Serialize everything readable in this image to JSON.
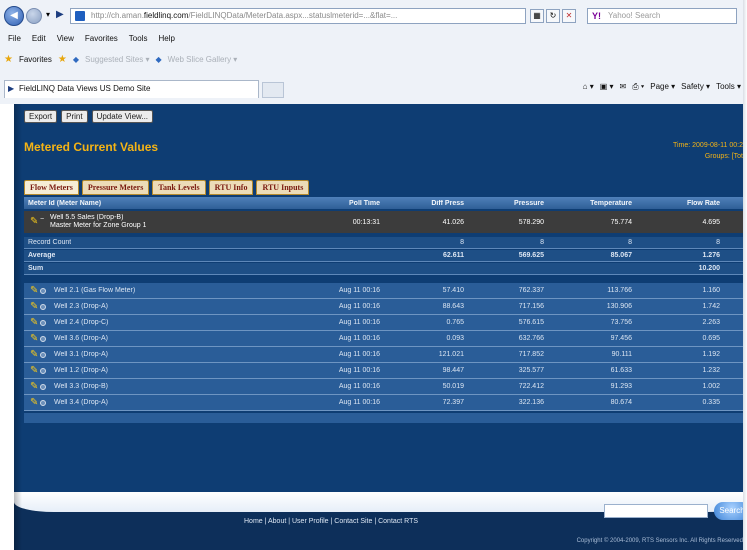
{
  "browser": {
    "url_prefix": "http://ch.aman.",
    "url_domain": "fieldlinq.com",
    "url_rest": "/FieldLINQData/MeterData.aspx...statuslmeterid=...&flat=...",
    "search_placeholder": "Yahoo! Search",
    "menu": [
      "File",
      "Edit",
      "View",
      "Favorites",
      "Tools",
      "Help"
    ],
    "favorites_label": "Favorites",
    "fav_links": [
      "Suggested Sites ▾",
      "Web Slice Gallery ▾"
    ],
    "tab_title": "FieldLINQ Data Views US Demo Site",
    "cmd": [
      "Page ▾",
      "Safety ▾",
      "Tools ▾"
    ]
  },
  "toolbar": {
    "export": "Export",
    "print": "Print",
    "update": "Update View..."
  },
  "page": {
    "title": "Metered Current Values",
    "time_line1": "Time: 2009-08-11 00:2",
    "time_line2": "Groups: [Tot"
  },
  "tabs": [
    "Flow Meters",
    "Pressure Meters",
    "Tank Levels",
    "RTU Info",
    "RTU Inputs"
  ],
  "columns": {
    "name": "Meter Id (Meter Name)",
    "poll": "Poll Time",
    "diff": "Diff Press",
    "press": "Pressure",
    "temp": "Temperature",
    "flow": "Flow Rate"
  },
  "selected": {
    "name_line1": "Well 5.5 Sales (Drop-B)",
    "name_line2": "Master Meter for Zone Group 1",
    "poll": "00:13:31",
    "diff": "41.026",
    "press": "578.290",
    "temp": "75.774",
    "flow": "4.695"
  },
  "summary": [
    {
      "label": "Record Count",
      "diff": "8",
      "press": "8",
      "temp": "8",
      "flow": "8"
    },
    {
      "label": "Average",
      "diff": "62.611",
      "press": "569.625",
      "temp": "85.067",
      "flow": "1.276"
    },
    {
      "label": "Sum",
      "diff": "",
      "press": "",
      "temp": "",
      "flow": "10.200"
    }
  ],
  "rows": [
    {
      "name": "Well 2.1 (Gas Flow Meter)",
      "poll": "Aug 11 00:16",
      "diff": "57.410",
      "press": "762.337",
      "temp": "113.766",
      "flow": "1.160"
    },
    {
      "name": "Well 2.3 (Drop-A)",
      "poll": "Aug 11 00:16",
      "diff": "88.643",
      "press": "717.156",
      "temp": "130.906",
      "flow": "1.742"
    },
    {
      "name": "Well 2.4 (Drop-C)",
      "poll": "Aug 11 00:16",
      "diff": "0.765",
      "press": "576.615",
      "temp": "73.756",
      "flow": "2.263"
    },
    {
      "name": "Well 3.6 (Drop-A)",
      "poll": "Aug 11 00:16",
      "diff": "0.093",
      "press": "632.766",
      "temp": "97.456",
      "flow": "0.695"
    },
    {
      "name": "Well 3.1 (Drop-A)",
      "poll": "Aug 11 00:16",
      "diff": "121.021",
      "press": "717.852",
      "temp": "90.111",
      "flow": "1.192"
    },
    {
      "name": "Well 1.2 (Drop-A)",
      "poll": "Aug 11 00:16",
      "diff": "98.447",
      "press": "325.577",
      "temp": "61.633",
      "flow": "1.232"
    },
    {
      "name": "Well 3.3 (Drop-B)",
      "poll": "Aug 11 00:16",
      "diff": "50.019",
      "press": "722.412",
      "temp": "91.293",
      "flow": "1.002"
    },
    {
      "name": "Well 3.4 (Drop-A)",
      "poll": "Aug 11 00:16",
      "diff": "72.397",
      "press": "322.136",
      "temp": "80.674",
      "flow": "0.335"
    }
  ],
  "footer": {
    "links": "Home | About | User Profile | Contact Site | Contact RTS",
    "go": "Search",
    "copyright": "Copyright © 2004-2009, RTS Sensors Inc. All Rights Reserved"
  }
}
